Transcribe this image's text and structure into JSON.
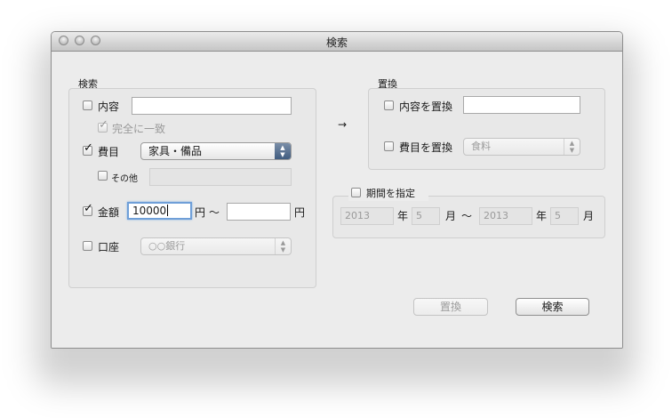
{
  "window": {
    "title": "検索"
  },
  "search": {
    "group_label": "検索",
    "content_label": "内容",
    "content_value": "",
    "exact_match_label": "完全に一致",
    "expense_label": "費目",
    "expense_selected": "家具・備品",
    "other_label": "その他",
    "other_value": "",
    "amount_label": "金額",
    "amount_from": "10000",
    "amount_unit": "円",
    "range_sep": "〜",
    "amount_to": "",
    "account_label": "口座",
    "account_selected": "○○銀行"
  },
  "replace": {
    "arrow": "→",
    "group_label": "置換",
    "content_label": "内容を置換",
    "content_value": "",
    "expense_label": "費目を置換",
    "expense_selected": "食料"
  },
  "period": {
    "label": "期間を指定",
    "from_year": "2013",
    "year_unit": "年",
    "from_month": "5",
    "month_unit": "月",
    "range_sep": "〜",
    "to_year": "2013",
    "to_month": "5"
  },
  "buttons": {
    "replace_label": "置換",
    "search_label": "検索"
  },
  "icons": {
    "check": "✓",
    "select_arrows_up": "▲",
    "select_arrows_down": "▼"
  }
}
